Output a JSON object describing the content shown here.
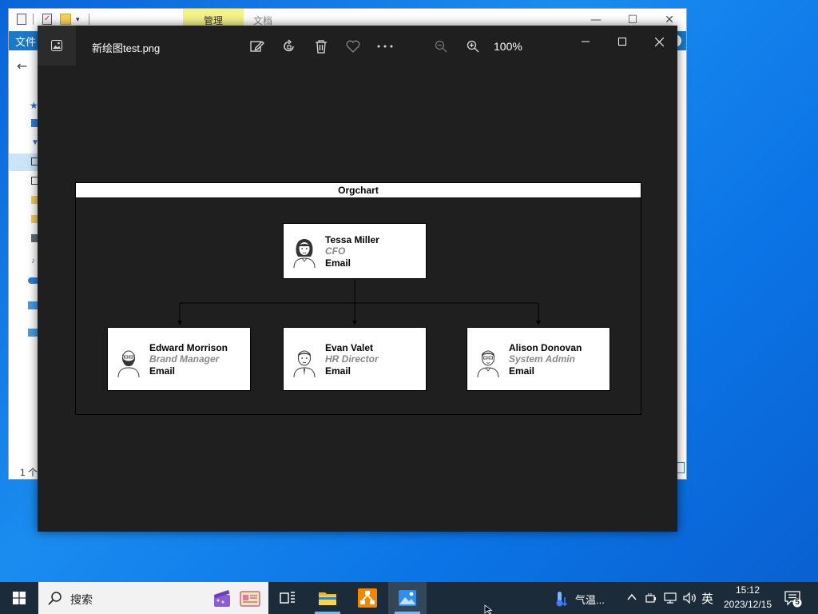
{
  "explorer": {
    "manage_tab": "管理",
    "doc_tab": "文档",
    "file_tab": "文件",
    "status_text": "1 个",
    "minimize": "—",
    "maximize": "☐",
    "close": "✕"
  },
  "viewer": {
    "filename": "新绘图test.png",
    "zoom": "100%",
    "toolbar": [
      "edit-image-icon",
      "rotate-icon",
      "delete-icon",
      "favorite-icon",
      "more-icon",
      "zoom-out-icon",
      "zoom-in-icon"
    ],
    "minimize": "—",
    "maximize": "☐",
    "close": "✕"
  },
  "orgchart": {
    "title": "Orgchart",
    "root": {
      "name": "Tessa Miller",
      "role": "CFO",
      "email": "Email"
    },
    "children": [
      {
        "name": "Edward Morrison",
        "role": "Brand Manager",
        "email": "Email"
      },
      {
        "name": "Evan Valet",
        "role": "HR Director",
        "email": "Email"
      },
      {
        "name": "Alison Donovan",
        "role": "System Admin",
        "email": "Email"
      }
    ]
  },
  "taskbar": {
    "search_placeholder": "搜索",
    "weather": "气温...",
    "ime": "英",
    "time": "15:12",
    "date": "2023/12/15",
    "notifications": "5"
  },
  "colors": {
    "desktop": "#0b74e6",
    "viewer_bg": "#1f1f1f",
    "taskbar": "#1c2b3a",
    "accent": "#76b9ed"
  }
}
